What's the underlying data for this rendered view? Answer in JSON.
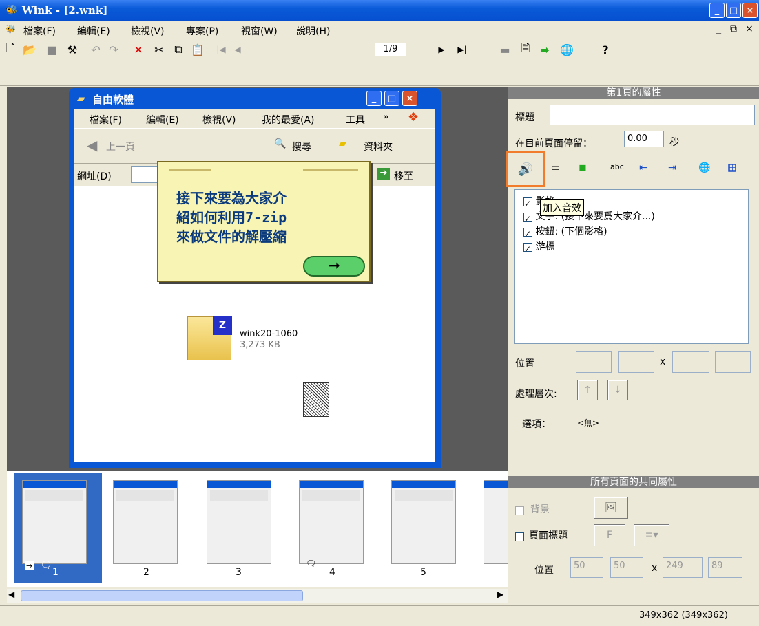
{
  "window": {
    "title": "Wink - [2.wnk]",
    "min": "_",
    "max": "□",
    "close": "×"
  },
  "menu": [
    "檔案(F)",
    "編輯(E)",
    "檢視(V)",
    "專案(P)",
    "視窗(W)",
    "說明(H)"
  ],
  "mdi_controls": {
    "min": "_",
    "restore": "⧉",
    "close": "×"
  },
  "toolbar": {
    "page_indicator": "1/9",
    "icons": [
      "new-icon",
      "open-icon",
      "save-icon",
      "build-icon",
      "undo-icon",
      "redo-icon",
      "delete-icon",
      "cut-icon",
      "copy-icon",
      "paste-icon",
      "first-frame-icon",
      "prev-frame-icon",
      "next-frame-icon",
      "last-frame-icon",
      "preview-icon",
      "render-icon",
      "arrow-icon",
      "globe-icon",
      "help-icon"
    ]
  },
  "explorer": {
    "title": "自由軟體",
    "menu": [
      "檔案(F)",
      "編輯(E)",
      "檢視(V)",
      "我的最愛(A)",
      "工具",
      "»"
    ],
    "nav": {
      "back": "上一頁",
      "search": "搜尋",
      "folders": "資料夾"
    },
    "address_label": "網址(D)",
    "go": "移至",
    "file": {
      "name": "wink20-1060",
      "size": "3,273 KB"
    }
  },
  "note": {
    "lines": [
      "接下來要為大家介",
      "紹如何利用7-zip",
      "來做文件的解壓縮"
    ],
    "arrow": "➞"
  },
  "props": {
    "header": "第1頁的屬性",
    "title_label": "標題",
    "title_value": "",
    "stay_label": "在目前頁面停留：",
    "stay_value": "0.00",
    "stay_unit": "秒",
    "tooltip": "加入音效",
    "layers": [
      {
        "label": "影格",
        "checked": true
      },
      {
        "label": "文字: (接下來要爲大家介...)",
        "checked": true
      },
      {
        "label": "按鈕: (下個影格)",
        "checked": true
      },
      {
        "label": "游標",
        "checked": true
      }
    ],
    "position_label": "位置",
    "x_sep": "x",
    "layer_order_label": "處理層次:",
    "options_label": "選項：",
    "options_value": "<無>"
  },
  "common_props": {
    "header": "所有頁面的共同屬性",
    "background_label": "背景",
    "page_title_label": "頁面標題",
    "font_btn": "F",
    "position_label": "位置",
    "pos": [
      "50",
      "50",
      "249",
      "89"
    ],
    "x_sep": "x"
  },
  "filmstrip": {
    "frames": [
      "1",
      "2",
      "3",
      "4",
      "5"
    ]
  },
  "status": {
    "size": "349x362 (349x362)"
  },
  "colors": {
    "accent": "#0a57d6",
    "highlight": "#f07c2c",
    "selected_frame": "#316ac5"
  }
}
